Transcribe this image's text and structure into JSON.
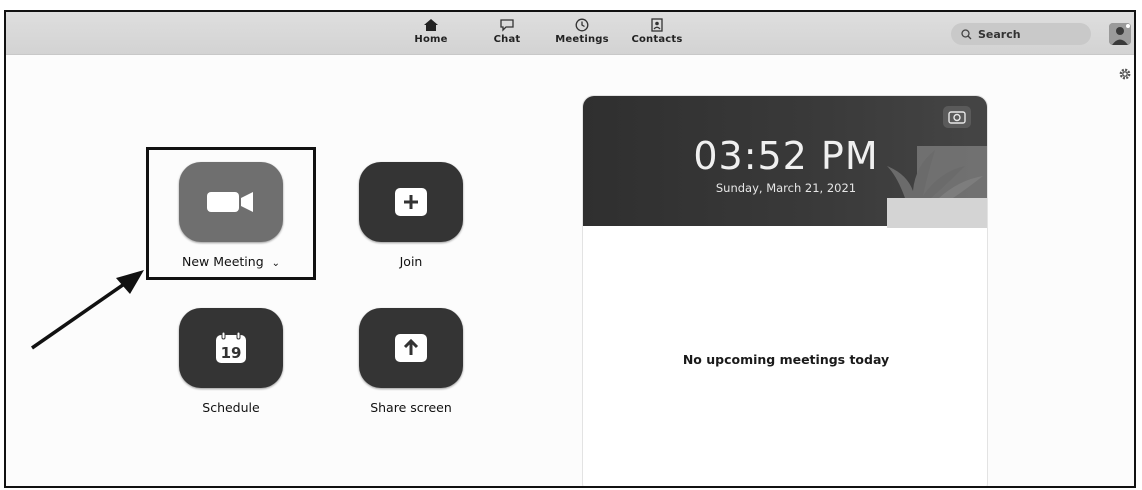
{
  "topbar": {
    "tabs": [
      {
        "label": "Home",
        "icon": "home-icon"
      },
      {
        "label": "Chat",
        "icon": "chat-icon"
      },
      {
        "label": "Meetings",
        "icon": "clock-icon"
      },
      {
        "label": "Contacts",
        "icon": "contacts-icon"
      }
    ],
    "search_label": "Search"
  },
  "actions": {
    "new_meeting": "New Meeting",
    "join": "Join",
    "schedule": "Schedule",
    "schedule_day": "19",
    "share_screen": "Share screen"
  },
  "card": {
    "time": "03:52 PM",
    "date": "Sunday, March 21, 2021",
    "empty_message": "No upcoming meetings today"
  },
  "colors": {
    "tile_dark": "#343434",
    "tile_highlight": "#6f6f6f",
    "topbar": "#d6d6d6"
  }
}
